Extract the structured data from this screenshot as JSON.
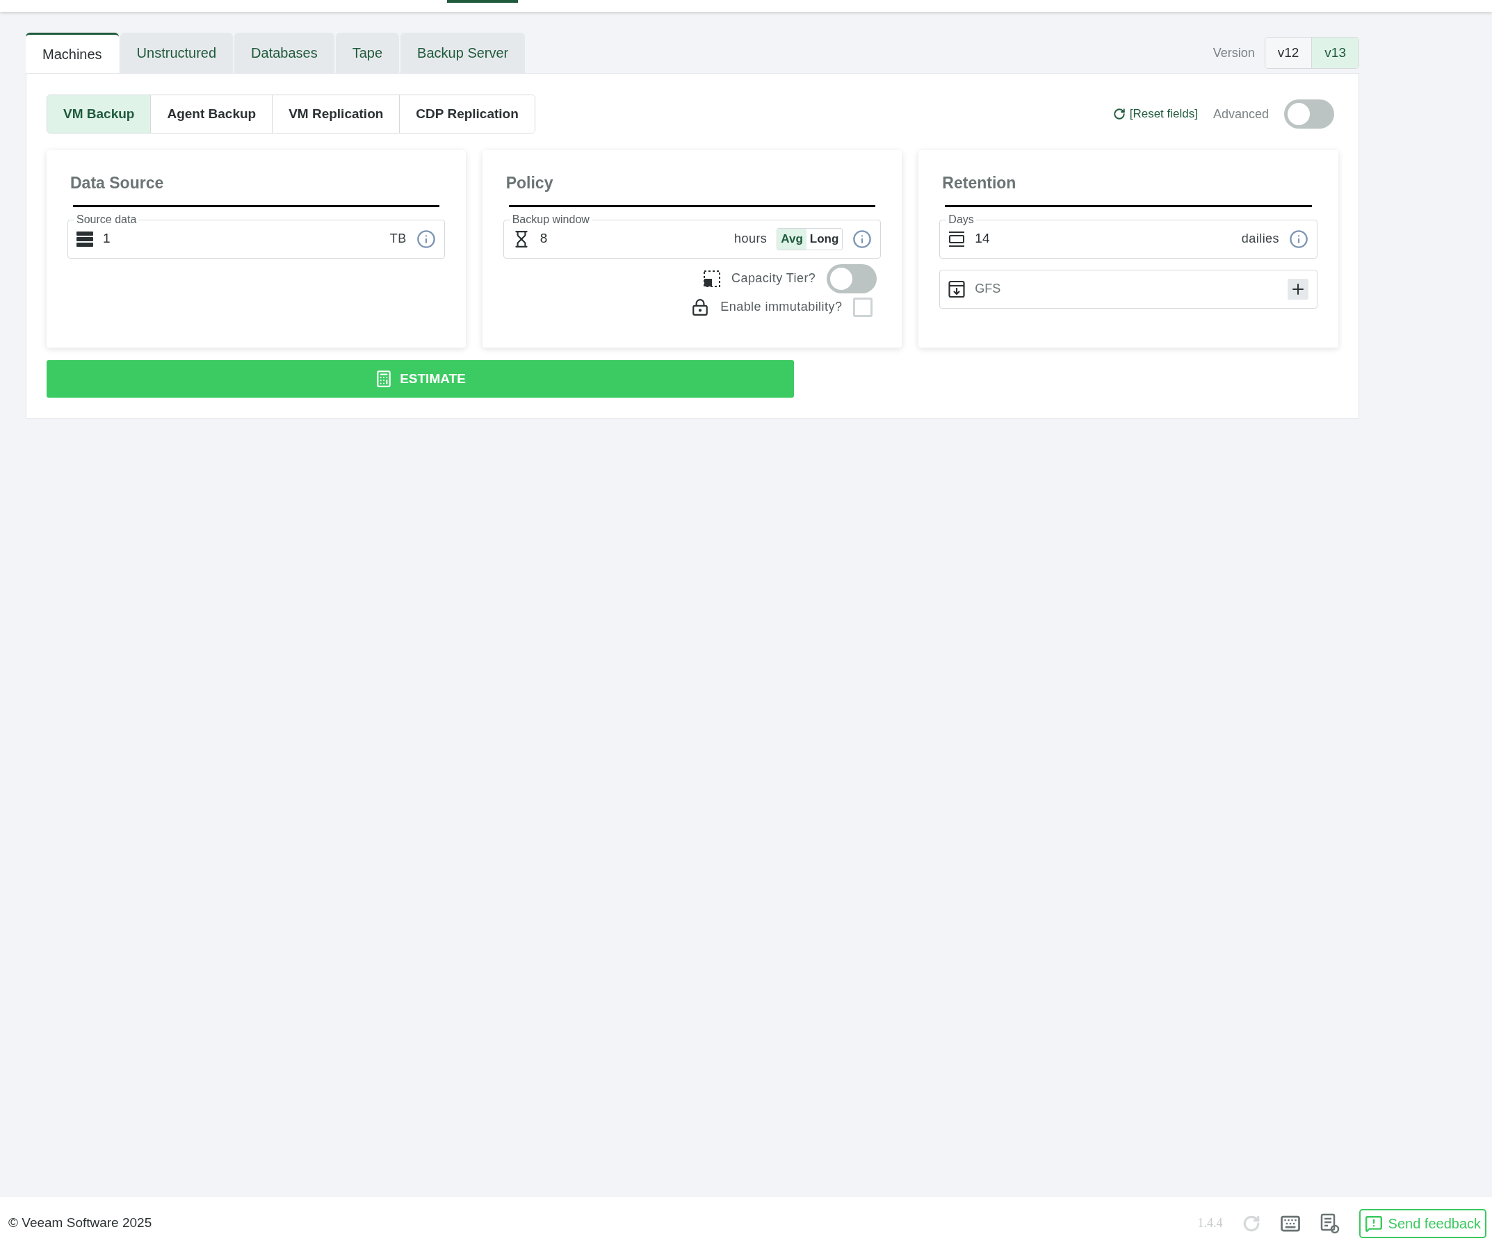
{
  "tabs": [
    {
      "label": "Machines",
      "selected": true
    },
    {
      "label": "Unstructured",
      "selected": false
    },
    {
      "label": "Databases",
      "selected": false
    },
    {
      "label": "Tape",
      "selected": false
    },
    {
      "label": "Backup Server",
      "selected": false
    }
  ],
  "version": {
    "label": "Version",
    "options": [
      {
        "label": "v12",
        "selected": false
      },
      {
        "label": "v13",
        "selected": true
      }
    ]
  },
  "subtabs": [
    {
      "label": "VM Backup",
      "selected": true
    },
    {
      "label": "Agent Backup",
      "selected": false
    },
    {
      "label": "VM Replication",
      "selected": false
    },
    {
      "label": "CDP Replication",
      "selected": false
    }
  ],
  "reset_fields": "[Reset fields]",
  "advanced": {
    "label": "Advanced",
    "on": false
  },
  "data_source": {
    "title": "Data Source",
    "field": {
      "legend": "Source data",
      "value": "1",
      "unit": "TB"
    }
  },
  "policy": {
    "title": "Policy",
    "field": {
      "legend": "Backup window",
      "value": "8",
      "unit": "hours",
      "modes": [
        {
          "label": "Avg",
          "selected": true
        },
        {
          "label": "Long",
          "selected": false
        }
      ]
    },
    "capacity_tier": {
      "label": "Capacity Tier?",
      "on": false
    },
    "immutability": {
      "label": "Enable immutability?",
      "checked": false
    }
  },
  "retention": {
    "title": "Retention",
    "field": {
      "legend": "Days",
      "value": "14",
      "unit": "dailies"
    },
    "gfs": {
      "label": "GFS"
    }
  },
  "estimate_button": "ESTIMATE",
  "footer": {
    "copyright": "© Veeam Software 2025",
    "version": "1.4.4",
    "feedback": "Send feedback"
  }
}
